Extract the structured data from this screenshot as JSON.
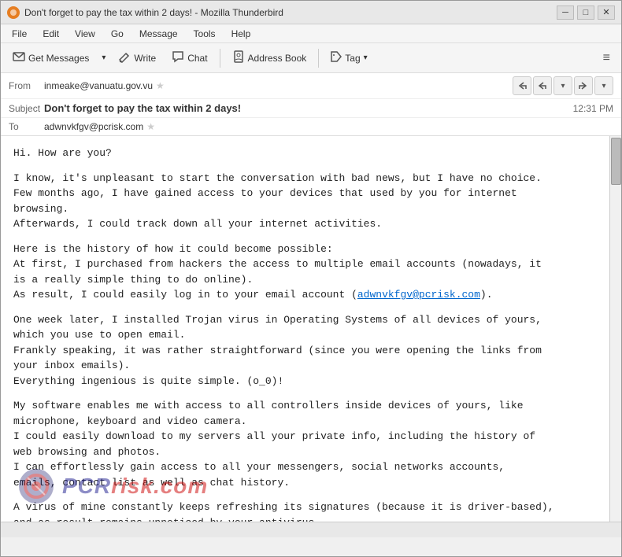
{
  "titleBar": {
    "title": "Don't forget to pay the tax within 2 days! - Mozilla Thunderbird",
    "iconLabel": "TB",
    "minBtn": "─",
    "maxBtn": "□",
    "closeBtn": "✕"
  },
  "menuBar": {
    "items": [
      "File",
      "Edit",
      "View",
      "Go",
      "Message",
      "Tools",
      "Help"
    ]
  },
  "toolbar": {
    "getMessages": "Get Messages",
    "write": "Write",
    "chat": "Chat",
    "addressBook": "Address Book",
    "tag": "Tag",
    "tagDropdown": "▾",
    "menuIcon": "≡"
  },
  "emailHeader": {
    "fromLabel": "From",
    "fromValue": "inmeake@vanuatu.gov.vu",
    "subjectLabel": "Subject",
    "subjectValue": "Don't forget to pay the tax within 2 days!",
    "time": "12:31 PM",
    "toLabel": "To",
    "toValue": "adwnvkfgv@pcrisk.com"
  },
  "navButtons": {
    "replyAll": "↩",
    "reply": "↺",
    "dropdown": "▾",
    "forward": "↪",
    "more": "▾"
  },
  "emailBody": {
    "paragraphs": [
      "Hi. How are you?",
      "I know, it's unpleasant to start the conversation with bad news, but I have no choice.\nFew months ago, I have gained access to your devices that used by you for internet\nbrowsing.\nAfterwards, I could track down all your internet activities.",
      "Here is the history of how it could become possible:\nAt first, I purchased from hackers the access to multiple email accounts (nowadays, it\nis a really simple thing to do online).\nAs result, I could easily log in to your email account (adwnvkfgv@pcrisk.com).",
      "One week later, I installed Trojan virus in Operating Systems of all devices of yours,\nwhich you use to open email.\nFrankly speaking, it was rather straightforward (since you were opening the links from\nyour inbox emails).\nEverything ingenious is quite simple. (o_0)!",
      "My software enables me with access to all controllers inside devices of yours, like\nmicrophone, keyboard and video camera.\nI could easily download to my servers all your private info, including the history of\nweb browsing and photos.\nI can effortlessly gain access to all your messengers, social networks accounts,\nemails, contact list as well as chat history.",
      "A virus of mine constantly keeps refreshing its signatures (because it is driver-based),\nand as result remains unnoticed by your antivirus."
    ],
    "emailLink": "adwnvkfgv@pcrisk.com"
  },
  "watermark": {
    "text": "risk.com"
  }
}
